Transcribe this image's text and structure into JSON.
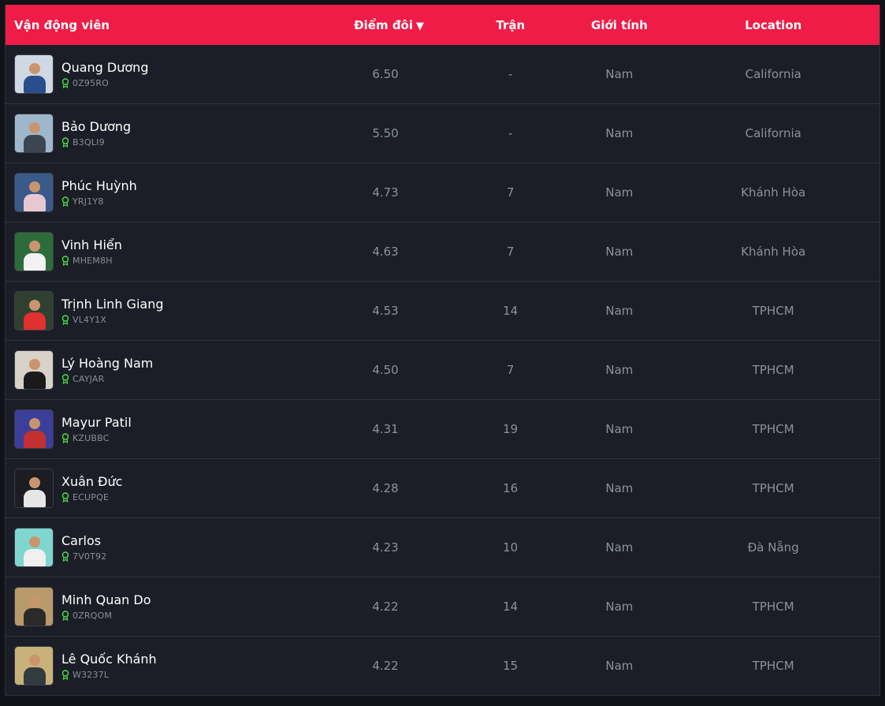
{
  "header": {
    "player": "Vận động viên",
    "doubles": "Điểm đôi",
    "matches": "Trận",
    "gender": "Giới tính",
    "location": "Location"
  },
  "colors": {
    "accent": "#ee1c47",
    "row_bg": "#1b1e26",
    "medal": "#4ade4a"
  },
  "players": [
    {
      "name": "Quang Dương",
      "code": "0Z95RO",
      "score": "6.50",
      "matches": "-",
      "gender": "Nam",
      "location": "California",
      "avatar_bg": "#cfd8e3",
      "avatar_fg": "#2a4e8c"
    },
    {
      "name": "Bảo Dương",
      "code": "B3QLI9",
      "score": "5.50",
      "matches": "-",
      "gender": "Nam",
      "location": "California",
      "avatar_bg": "#9fb7cc",
      "avatar_fg": "#3c4552"
    },
    {
      "name": "Phúc Huỳnh",
      "code": "YRJ1Y8",
      "score": "4.73",
      "matches": "7",
      "gender": "Nam",
      "location": "Khánh Hòa",
      "avatar_bg": "#3a5a8a",
      "avatar_fg": "#e8c8d0"
    },
    {
      "name": "Vinh Hiển",
      "code": "MHEM8H",
      "score": "4.63",
      "matches": "7",
      "gender": "Nam",
      "location": "Khánh Hòa",
      "avatar_bg": "#2e6b3a",
      "avatar_fg": "#f2f2f2"
    },
    {
      "name": "Trịnh Linh Giang",
      "code": "VL4Y1X",
      "score": "4.53",
      "matches": "14",
      "gender": "Nam",
      "location": "TPHCM",
      "avatar_bg": "#2f4030",
      "avatar_fg": "#e03030"
    },
    {
      "name": "Lý Hoàng Nam",
      "code": "CAYJAR",
      "score": "4.50",
      "matches": "7",
      "gender": "Nam",
      "location": "TPHCM",
      "avatar_bg": "#d8d2c8",
      "avatar_fg": "#1a1a1a"
    },
    {
      "name": "Mayur Patil",
      "code": "KZUBBC",
      "score": "4.31",
      "matches": "19",
      "gender": "Nam",
      "location": "TPHCM",
      "avatar_bg": "#3b3f9a",
      "avatar_fg": "#c23030"
    },
    {
      "name": "Xuân Đức",
      "code": "ECUPQE",
      "score": "4.28",
      "matches": "16",
      "gender": "Nam",
      "location": "TPHCM",
      "avatar_bg": "#1c1c22",
      "avatar_fg": "#e6e6e6"
    },
    {
      "name": "Carlos",
      "code": "7V0T92",
      "score": "4.23",
      "matches": "10",
      "gender": "Nam",
      "location": "Đà Nẵng",
      "avatar_bg": "#7fd6cf",
      "avatar_fg": "#f0f0f0"
    },
    {
      "name": "Minh Quan Do",
      "code": "0ZRQOM",
      "score": "4.22",
      "matches": "14",
      "gender": "Nam",
      "location": "TPHCM",
      "avatar_bg": "#b99a6a",
      "avatar_fg": "#2a2a2a"
    },
    {
      "name": "Lê Quốc Khánh",
      "code": "W3237L",
      "score": "4.22",
      "matches": "15",
      "gender": "Nam",
      "location": "TPHCM",
      "avatar_bg": "#c9b27a",
      "avatar_fg": "#333a40"
    }
  ]
}
